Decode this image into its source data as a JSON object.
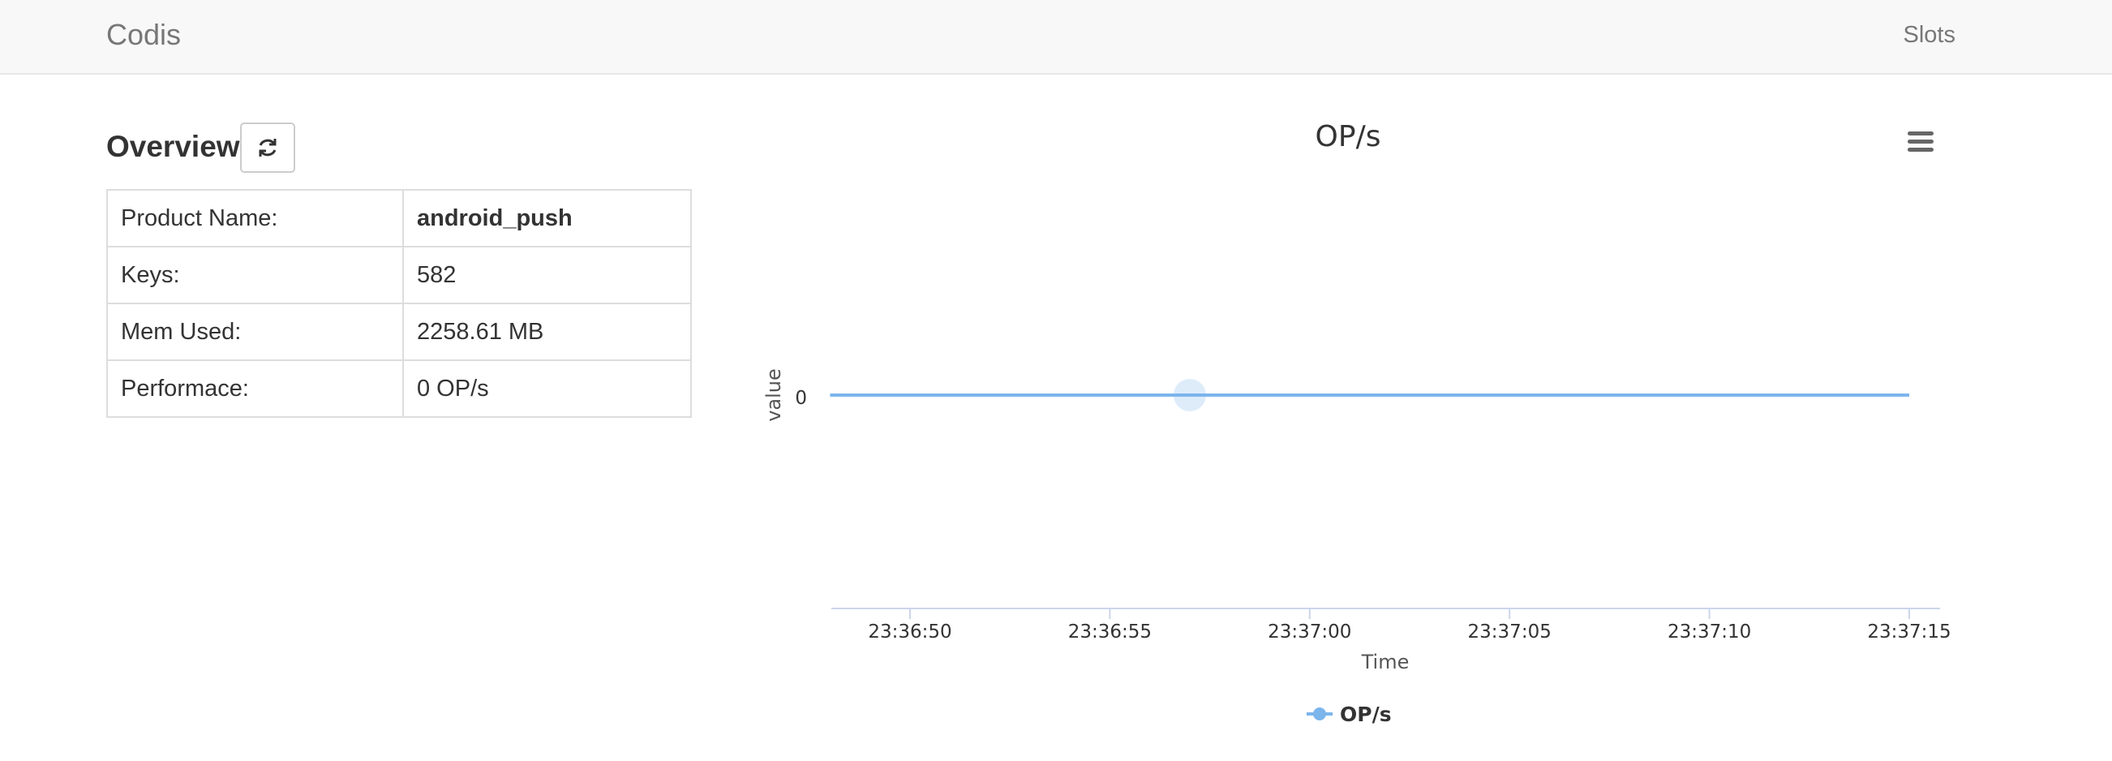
{
  "navbar": {
    "brand": "Codis",
    "slots_link": "Slots"
  },
  "overview": {
    "title": "Overview",
    "refresh_icon": "refresh-icon",
    "rows": [
      {
        "label": "Product Name:",
        "value": "android_push",
        "bold": true
      },
      {
        "label": "Keys:",
        "value": "582"
      },
      {
        "label": "Mem Used:",
        "value": "2258.61 MB"
      },
      {
        "label": "Performace:",
        "value": "0 OP/s"
      }
    ]
  },
  "chart_menu_icon": "hamburger-menu-icon",
  "chart_data": {
    "type": "line",
    "title": "OP/s",
    "xlabel": "Time",
    "ylabel": "value",
    "x_tick_labels": [
      "23:36:50",
      "23:36:55",
      "23:37:00",
      "23:37:05",
      "23:37:10",
      "23:37:15"
    ],
    "y_tick_labels": [
      "0"
    ],
    "series": [
      {
        "name": "OP/s",
        "color": "#7cb5ec",
        "points": [
          {
            "x": "23:36:48",
            "y": 0
          },
          {
            "x": "23:37:15",
            "y": 0
          }
        ],
        "hover_x": "23:36:57"
      }
    ],
    "legend": "bottom-center",
    "grid": false
  }
}
